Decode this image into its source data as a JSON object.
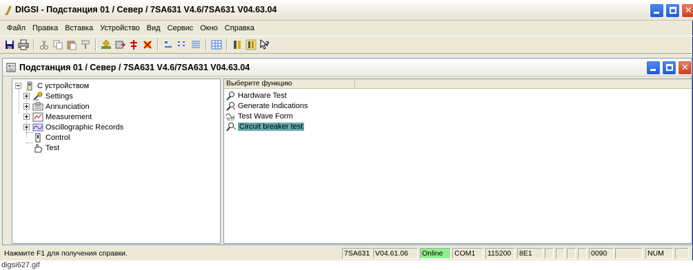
{
  "window": {
    "title": "DIGSI - Подстанция 01 / Север / 7SA631 V4.6/7SA631 V04.63.04"
  },
  "menu": [
    "Файл",
    "Правка",
    "Вставка",
    "Устройство",
    "Вид",
    "Сервис",
    "Окно",
    "Справка"
  ],
  "toolbar": {
    "icons": [
      "save-icon",
      "print-icon",
      "cut-icon",
      "copy-icon",
      "paste-icon",
      "format-painter-icon",
      "upload-icon",
      "device-icon",
      "tree-icon",
      "network-icon",
      "small-icons-icon",
      "list-view-icon",
      "details-view-icon",
      "grid-icon",
      "device-online-icon",
      "device-offline-icon",
      "context-help-icon"
    ]
  },
  "child": {
    "title": "Подстанция 01 / Север / 7SA631 V4.6/7SA631 V04.63.04"
  },
  "tree": {
    "root": "С устройством",
    "items": [
      "Settings",
      "Annunciation",
      "Measurement",
      "Oscillographic Records",
      "Control",
      "Test"
    ]
  },
  "list": {
    "header": "Выберите функцию",
    "items": [
      "Hardware Test",
      "Generate Indications",
      "Test Wave Form",
      "Circuit breaker test"
    ],
    "selected": "Circuit breaker test"
  },
  "status": {
    "help": "Нажмите F1 для получения справки.",
    "device": "7SA631",
    "version": "V04.61.06",
    "mode": "Online",
    "port": "COM1",
    "baud": "115200",
    "frame": "8E1",
    "address": "0090",
    "num": "NUM"
  },
  "caption": "digsi627.gif",
  "colors": {
    "selection": "#66aaaa",
    "online": "#90ee90",
    "title_button_blue": "#2259d6",
    "title_button_red": "#c8401f"
  }
}
